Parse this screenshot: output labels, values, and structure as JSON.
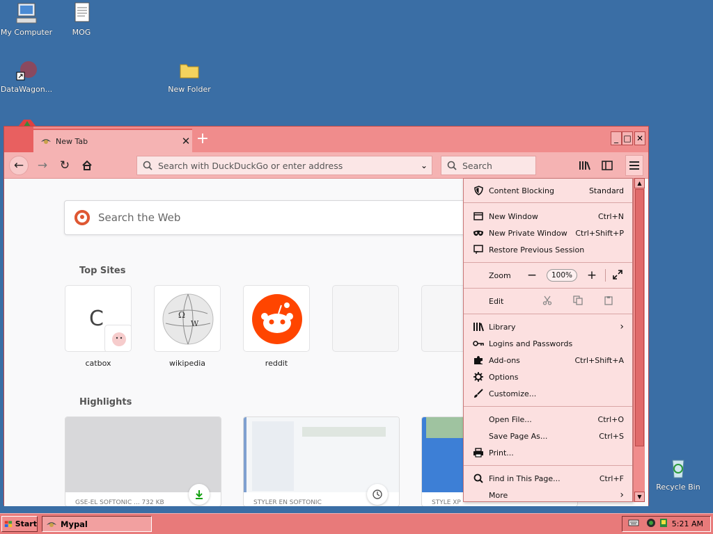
{
  "desktop": {
    "icons": [
      {
        "label": "My Computer"
      },
      {
        "label": "MOG"
      },
      {
        "label": "DataWagon..."
      },
      {
        "label": "New Folder"
      },
      {
        "label": "Recycle Bin"
      }
    ]
  },
  "browser": {
    "tab_title": "New Tab",
    "tab_close": "✕",
    "new_tab": "+",
    "window_controls": {
      "minimize": "_",
      "maximize": "□",
      "close": "✕"
    },
    "url_placeholder": "Search with DuckDuckGo or enter address",
    "search_placeholder": "Search"
  },
  "newtab": {
    "web_search_placeholder": "Search the Web",
    "top_sites_title": "Top Sites",
    "top_sites": [
      {
        "name": "catbox",
        "letter": "C"
      },
      {
        "name": "wikipedia"
      },
      {
        "name": "reddit"
      },
      {
        "name": ""
      },
      {
        "name": ""
      }
    ],
    "highlights_title": "Highlights",
    "highlights": [
      {
        "caption": "GSE-EL SOFTONIC ... 732 KB"
      },
      {
        "caption": "STYLER EN SOFTONIC"
      },
      {
        "caption": "STYLE XP"
      }
    ]
  },
  "app_menu": {
    "content_blocking": {
      "label": "Content Blocking",
      "value": "Standard"
    },
    "new_window": {
      "label": "New Window",
      "shortcut": "Ctrl+N"
    },
    "new_private_window": {
      "label": "New Private Window",
      "shortcut": "Ctrl+Shift+P"
    },
    "restore_session": {
      "label": "Restore Previous Session"
    },
    "zoom": {
      "label": "Zoom",
      "minus": "−",
      "value": "100%",
      "plus": "+"
    },
    "edit": {
      "label": "Edit"
    },
    "library": {
      "label": "Library"
    },
    "logins": {
      "label": "Logins and Passwords"
    },
    "addons": {
      "label": "Add-ons",
      "shortcut": "Ctrl+Shift+A"
    },
    "options": {
      "label": "Options"
    },
    "customize": {
      "label": "Customize..."
    },
    "open_file": {
      "label": "Open File...",
      "shortcut": "Ctrl+O"
    },
    "save_page": {
      "label": "Save Page As...",
      "shortcut": "Ctrl+S"
    },
    "print": {
      "label": "Print..."
    },
    "find": {
      "label": "Find in This Page...",
      "shortcut": "Ctrl+F"
    },
    "more": {
      "label": "More"
    }
  },
  "taskbar": {
    "start_label": "Start",
    "task_label": "Mypal",
    "clock": "5:21 AM"
  },
  "colors": {
    "desktop": "#3a6ea5",
    "chrome_accent": "#f08c8c",
    "menu_bg": "#fce0e0"
  }
}
